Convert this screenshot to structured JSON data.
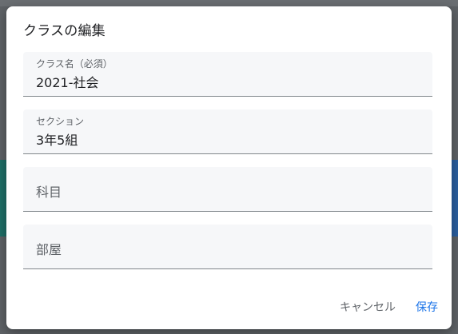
{
  "dialog": {
    "title": "クラスの編集"
  },
  "fields": {
    "class_name": {
      "label": "クラス名（必須）",
      "value": "2021-社会"
    },
    "section": {
      "label": "セクション",
      "value": "3年5組"
    },
    "subject": {
      "placeholder": "科目"
    },
    "room": {
      "placeholder": "部屋"
    }
  },
  "actions": {
    "cancel_label": "キャンセル",
    "save_label": "保存"
  },
  "colors": {
    "accent": "#1a73e8",
    "field_bg": "#f6f7f9",
    "backdrop": "#5e6266"
  }
}
